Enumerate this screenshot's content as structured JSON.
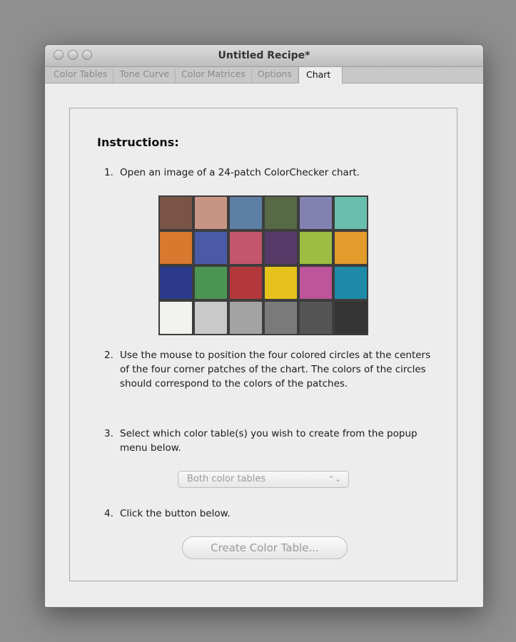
{
  "window": {
    "title": "Untitled Recipe*"
  },
  "tabs": [
    {
      "label": "Color Tables"
    },
    {
      "label": "Tone Curve"
    },
    {
      "label": "Color Matrices"
    },
    {
      "label": "Options"
    },
    {
      "label": "Chart"
    }
  ],
  "active_tab": "Chart",
  "instructions": {
    "heading": "Instructions:",
    "steps": [
      {
        "num": "1.",
        "text": "Open an image of a 24-patch ColorChecker chart."
      },
      {
        "num": "2.",
        "text": "Use the mouse to position the four colored circles at the centers of the four corner patches of the chart. The colors of the circles should correspond to the colors of the patches."
      },
      {
        "num": "3.",
        "text": "Select which color table(s) you wish to create from the popup menu below."
      },
      {
        "num": "4.",
        "text": "Click the button below."
      }
    ]
  },
  "colorchecker": {
    "patches": [
      "#7a5546",
      "#c89585",
      "#5d7fa6",
      "#566a45",
      "#8281b0",
      "#69bfae",
      "#d9792e",
      "#4a5aa6",
      "#c4566b",
      "#573a67",
      "#9dbd42",
      "#e39b2c",
      "#2c3a8c",
      "#4c9452",
      "#b2383b",
      "#e7c11d",
      "#bc5599",
      "#1e8aa8",
      "#f2f2ee",
      "#c9c9c9",
      "#a3a3a3",
      "#7a7a7a",
      "#555555",
      "#343434"
    ]
  },
  "popup": {
    "selected": "Both color tables",
    "arrow_glyph": "⌃⌄"
  },
  "create_button": {
    "label": "Create Color Table..."
  }
}
